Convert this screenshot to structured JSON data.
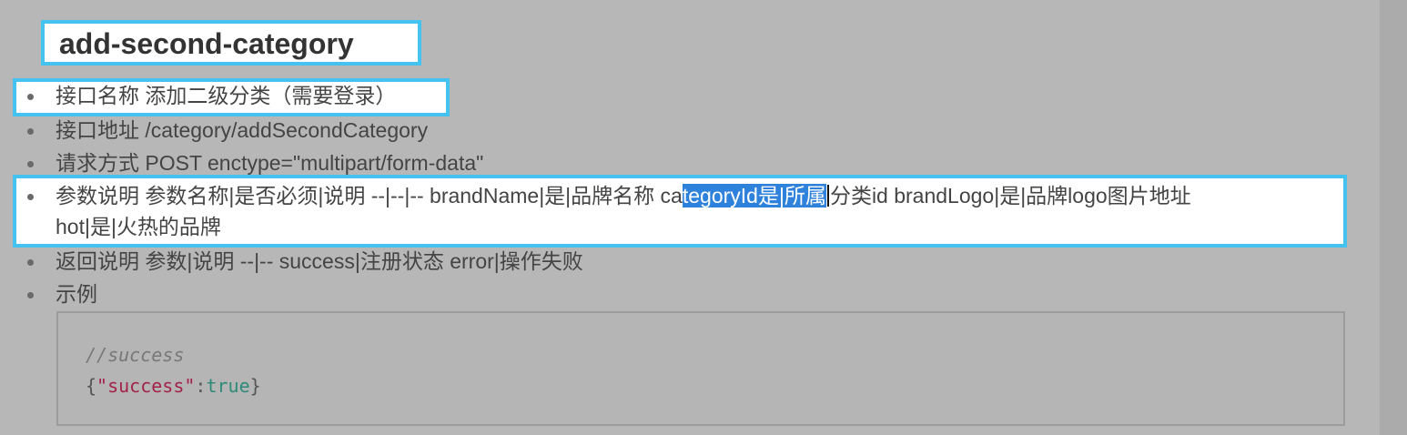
{
  "title": "add-second-category",
  "items": [
    {
      "label": "接口名称 添加二级分类（需要登录）"
    },
    {
      "label": "接口地址 /category/addSecondCategory"
    },
    {
      "label": "请求方式 POST enctype=\"multipart/form-data\""
    },
    {
      "pre": "参数说明 参数名称|是否必须|说明 --|--|-- brandName|是|品牌名称 ca",
      "selected": "tegoryId是|所属",
      "post": "分类id brandLogo|是|品牌logo图片地址",
      "line2": "hot|是|火热的品牌"
    },
    {
      "label": "返回说明 参数|说明 --|-- success|注册状态 error|操作失败"
    },
    {
      "label": "示例"
    }
  ],
  "code": {
    "comment": "//success",
    "brace_open": "{",
    "key": "\"success\"",
    "colon": ":",
    "value": "true",
    "brace_close": "}"
  }
}
